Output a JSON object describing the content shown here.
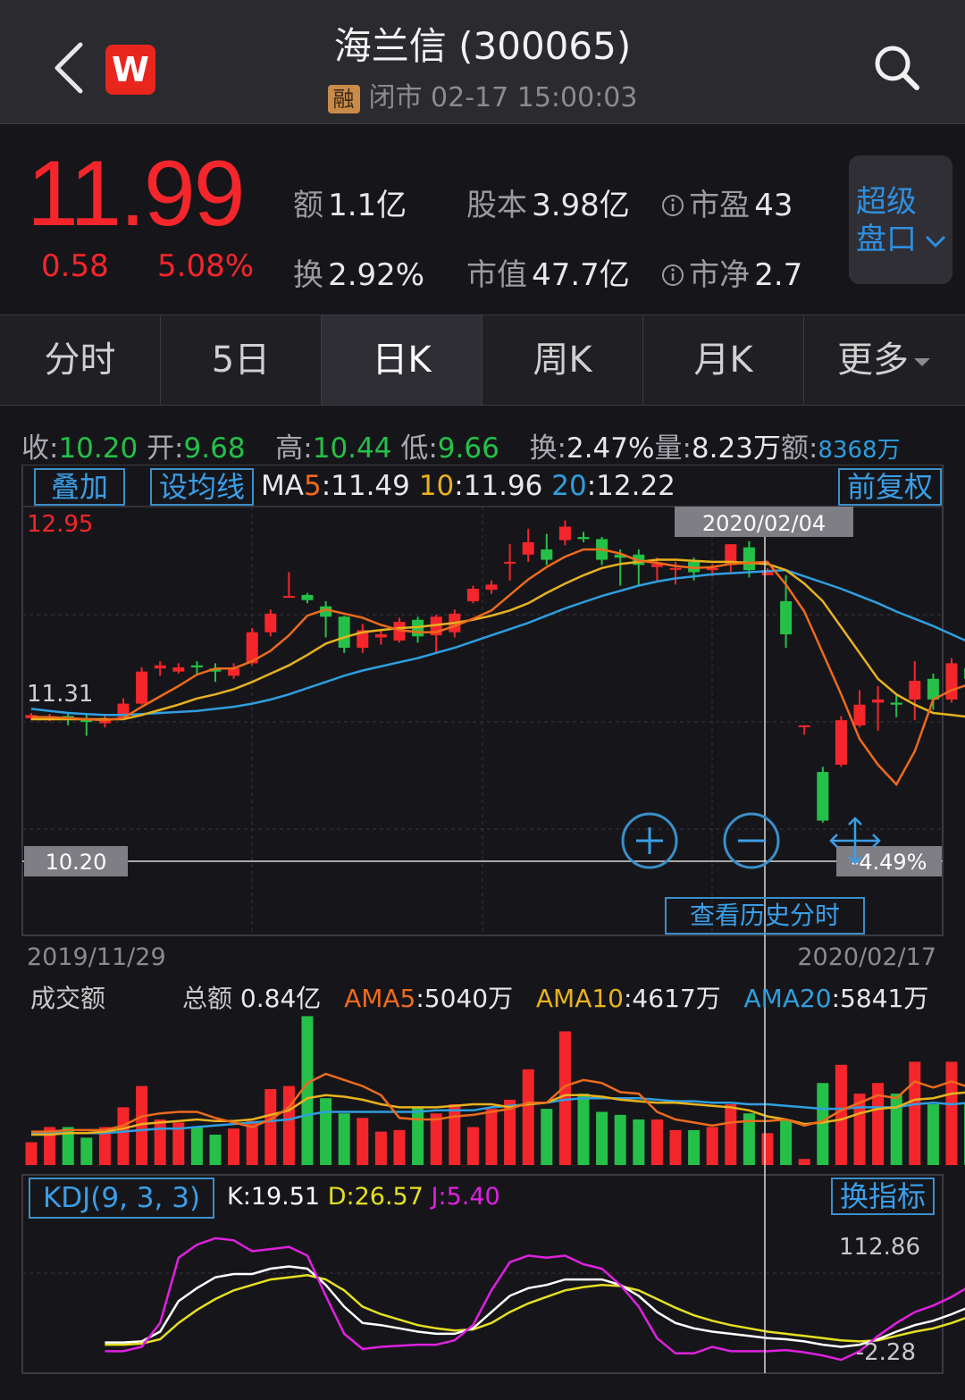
{
  "header": {
    "back_icon": "chevron-left-icon",
    "logo_text": "W",
    "title": "海兰信 (300065)",
    "badge": "融",
    "status": "闭市 02-17 15:00:03",
    "search_icon": "search-icon"
  },
  "quote": {
    "price": "11.99",
    "change": "0.58",
    "change_pct": "5.08%",
    "amount_label": "额",
    "amount": "1.1亿",
    "turnover_label": "换",
    "turnover": "2.92%",
    "share_cap_label": "股本",
    "share_cap": "3.98亿",
    "mkt_cap_label": "市值",
    "mkt_cap": "47.7亿",
    "pe_label": "市盈",
    "pe": "43",
    "pb_label": "市净",
    "pb": "2.7",
    "deep_book": "超级盘口",
    "price_color": "#f5262b"
  },
  "tabs": [
    {
      "label": "分时"
    },
    {
      "label": "5日"
    },
    {
      "label": "日K"
    },
    {
      "label": "周K"
    },
    {
      "label": "月K"
    },
    {
      "label": "更多"
    }
  ],
  "info_row": {
    "close_label": "收:",
    "close": "10.20",
    "open_label": "开:",
    "open": "9.68",
    "high_label": "高:",
    "high": "10.44",
    "low_label": "低:",
    "low": "9.66",
    "turn_label": "换:",
    "turn": "2.47%",
    "vol_label": "量:",
    "vol": "8.23万",
    "amt_label": "额:",
    "amt": "8368万"
  },
  "kline": {
    "overlay_btn": "叠加",
    "ma_btn": "设均线",
    "ma_prefix": "MA",
    "ma5_key": "5",
    "ma5": ":11.49",
    "ma10_key": "10",
    "ma10": ":11.96",
    "ma20_key": "20",
    "ma20": ":12.22",
    "adj_btn": "前复权",
    "y_high": "12.95",
    "y_mid": "11.31",
    "cursor_date": "2020/02/04",
    "cursor_price": "10.20",
    "cursor_pct": "-4.49%",
    "history_btn": "查看历史分时",
    "x_start": "2019/11/29",
    "x_end": "2020/02/17"
  },
  "volume": {
    "title": "成交额",
    "total_label": "总额",
    "total": "0.84亿",
    "ama5_label": "AMA5",
    "ama5": ":5040万",
    "ama10_label": "AMA10",
    "ama10": ":4617万",
    "ama20_label": "AMA20",
    "ama20": ":5841万"
  },
  "kdj": {
    "title": "KDJ(9, 3, 3)",
    "k_label": "K",
    "k": ":19.51",
    "d_label": "D",
    "d": ":26.57",
    "j_label": "J",
    "j": ":5.40",
    "switch_btn": "换指标",
    "y_top": "112.86",
    "y_bottom": "-2.28"
  },
  "colors": {
    "up": "#f5262b",
    "down": "#25c048",
    "ma5": "#ee6a1c",
    "ma10": "#e8b21e",
    "ma20": "#2f9ee0",
    "k": "#ffffff",
    "d": "#e6e020",
    "j": "#e020e0"
  },
  "chart_data": {
    "candles": [
      [
        11.07,
        11.1,
        11.05,
        11.12
      ],
      [
        11.08,
        11.09,
        11.04,
        11.11
      ],
      [
        11.09,
        11.06,
        11.0,
        11.12
      ],
      [
        11.05,
        11.04,
        10.9,
        11.12
      ],
      [
        11.02,
        11.05,
        10.98,
        11.1
      ],
      [
        11.08,
        11.21,
        11.06,
        11.26
      ],
      [
        11.21,
        11.52,
        11.2,
        11.56
      ],
      [
        11.55,
        11.58,
        11.48,
        11.62
      ],
      [
        11.52,
        11.56,
        11.5,
        11.6
      ],
      [
        11.58,
        11.56,
        11.48,
        11.62
      ],
      [
        11.55,
        11.52,
        11.42,
        11.6
      ],
      [
        11.48,
        11.55,
        11.45,
        11.6
      ],
      [
        11.6,
        11.9,
        11.58,
        11.94
      ],
      [
        11.9,
        12.08,
        11.86,
        12.12
      ],
      [
        12.25,
        12.25,
        12.24,
        12.48
      ],
      [
        12.26,
        12.21,
        12.18,
        12.28
      ],
      [
        12.15,
        12.05,
        11.85,
        12.2
      ],
      [
        12.05,
        11.75,
        11.7,
        12.06
      ],
      [
        11.75,
        11.92,
        11.7,
        11.98
      ],
      [
        11.85,
        11.88,
        11.78,
        11.92
      ],
      [
        11.82,
        12.0,
        11.8,
        12.04
      ],
      [
        12.02,
        11.86,
        11.8,
        12.05
      ],
      [
        11.87,
        12.05,
        11.7,
        12.07
      ],
      [
        11.9,
        12.08,
        11.85,
        12.12
      ],
      [
        12.2,
        12.32,
        12.18,
        12.35
      ],
      [
        12.31,
        12.36,
        12.27,
        12.4
      ],
      [
        12.58,
        12.58,
        12.4,
        12.75
      ],
      [
        12.65,
        12.77,
        12.58,
        12.9
      ],
      [
        12.7,
        12.6,
        12.55,
        12.85
      ],
      [
        12.79,
        12.92,
        12.74,
        12.98
      ],
      [
        12.82,
        12.8,
        12.77,
        12.87
      ],
      [
        12.8,
        12.6,
        12.55,
        12.82
      ],
      [
        12.65,
        12.62,
        12.35,
        12.7
      ],
      [
        12.65,
        12.55,
        12.35,
        12.7
      ],
      [
        12.53,
        12.56,
        12.4,
        12.62
      ],
      [
        12.52,
        12.52,
        12.36,
        12.58
      ],
      [
        12.58,
        12.48,
        12.4,
        12.62
      ],
      [
        12.5,
        12.52,
        12.44,
        12.56
      ],
      [
        12.55,
        12.75,
        12.47,
        12.75
      ],
      [
        12.72,
        12.5,
        12.43,
        12.78
      ],
      [
        12.45,
        12.5,
        12.46,
        12.52
      ],
      [
        12.2,
        11.88,
        11.75,
        12.45
      ],
      [
        11.0,
        11.0,
        10.91,
        11.0
      ],
      [
        10.55,
        10.08,
        10.06,
        10.6
      ],
      [
        10.62,
        11.05,
        10.6,
        11.09
      ],
      [
        11.0,
        11.2,
        10.98,
        11.34
      ],
      [
        11.22,
        11.25,
        10.95,
        11.38
      ],
      [
        11.22,
        11.2,
        11.08,
        11.3
      ],
      [
        11.25,
        11.43,
        11.05,
        11.62
      ],
      [
        11.45,
        11.25,
        11.15,
        11.5
      ],
      [
        11.25,
        11.6,
        11.22,
        11.65
      ],
      [
        11.55,
        11.45,
        11.4,
        11.62
      ],
      [
        11.4,
        11.45,
        11.23,
        11.55
      ],
      [
        11.41,
        11.82,
        11.4,
        11.84
      ]
    ],
    "ma5": [
      11.08,
      11.08,
      11.07,
      11.06,
      11.05,
      11.07,
      11.18,
      11.28,
      11.38,
      11.49,
      11.55,
      11.55,
      11.62,
      11.72,
      11.87,
      12.06,
      12.12,
      12.08,
      12.04,
      11.97,
      11.92,
      11.9,
      11.9,
      11.96,
      12.03,
      12.11,
      12.26,
      12.41,
      12.53,
      12.63,
      12.7,
      12.7,
      12.66,
      12.59,
      12.57,
      12.54,
      12.52,
      12.53,
      12.56,
      12.57,
      12.58,
      12.36,
      12.1,
      11.7,
      11.3,
      10.87,
      10.62,
      10.43,
      10.75,
      11.25,
      11.34,
      11.4,
      11.45,
      11.5
    ],
    "ma10": [
      11.06,
      11.06,
      11.06,
      11.06,
      11.06,
      11.06,
      11.1,
      11.15,
      11.2,
      11.26,
      11.3,
      11.35,
      11.42,
      11.5,
      11.58,
      11.68,
      11.79,
      11.85,
      11.9,
      11.92,
      11.94,
      11.95,
      11.97,
      11.99,
      12.02,
      12.06,
      12.11,
      12.18,
      12.28,
      12.37,
      12.45,
      12.52,
      12.56,
      12.58,
      12.6,
      12.6,
      12.59,
      12.58,
      12.58,
      12.57,
      12.56,
      12.5,
      12.37,
      12.2,
      11.95,
      11.7,
      11.45,
      11.3,
      11.2,
      11.12,
      11.1,
      11.08,
      11.12,
      11.0
    ],
    "ma20": [
      11.16,
      11.14,
      11.12,
      11.11,
      11.1,
      11.1,
      11.11,
      11.12,
      11.13,
      11.14,
      11.16,
      11.18,
      11.21,
      11.25,
      11.3,
      11.36,
      11.42,
      11.48,
      11.53,
      11.57,
      11.61,
      11.65,
      11.7,
      11.75,
      11.81,
      11.87,
      11.93,
      11.99,
      12.06,
      12.13,
      12.19,
      12.25,
      12.3,
      12.35,
      12.39,
      12.42,
      12.44,
      12.46,
      12.47,
      12.48,
      12.49,
      12.5,
      12.44,
      12.38,
      12.32,
      12.25,
      12.18,
      12.1,
      12.03,
      11.96,
      11.88,
      11.8,
      11.74,
      11.71
    ],
    "turnover": [
      0.15,
      0.25,
      0.25,
      0.18,
      0.25,
      0.38,
      0.52,
      0.3,
      0.28,
      0.25,
      0.2,
      0.24,
      0.29,
      0.5,
      0.52,
      0.98,
      0.44,
      0.34,
      0.31,
      0.22,
      0.23,
      0.38,
      0.34,
      0.4,
      0.25,
      0.37,
      0.43,
      0.63,
      0.37,
      0.88,
      0.47,
      0.35,
      0.33,
      0.3,
      0.3,
      0.23,
      0.23,
      0.25,
      0.4,
      0.34,
      0.21,
      0.3,
      0.04,
      0.54,
      0.66,
      0.47,
      0.54,
      0.47,
      0.68,
      0.4,
      0.68,
      0.4,
      0.44,
      0.76
    ],
    "ama5_vals": [
      0.22,
      0.22,
      0.23,
      0.23,
      0.23,
      0.26,
      0.32,
      0.34,
      0.35,
      0.35,
      0.31,
      0.28,
      0.25,
      0.3,
      0.38,
      0.54,
      0.6,
      0.56,
      0.52,
      0.46,
      0.31,
      0.3,
      0.3,
      0.32,
      0.33,
      0.35,
      0.37,
      0.41,
      0.41,
      0.52,
      0.56,
      0.54,
      0.48,
      0.47,
      0.35,
      0.3,
      0.28,
      0.26,
      0.28,
      0.29,
      0.29,
      0.3,
      0.26,
      0.29,
      0.36,
      0.41,
      0.46,
      0.44,
      0.55,
      0.51,
      0.55,
      0.51,
      0.52,
      0.54
    ],
    "ama10_vals": [
      0.2,
      0.2,
      0.21,
      0.21,
      0.22,
      0.24,
      0.27,
      0.28,
      0.29,
      0.3,
      0.29,
      0.29,
      0.3,
      0.33,
      0.36,
      0.44,
      0.46,
      0.45,
      0.43,
      0.4,
      0.38,
      0.38,
      0.38,
      0.39,
      0.4,
      0.4,
      0.38,
      0.4,
      0.41,
      0.46,
      0.46,
      0.45,
      0.43,
      0.42,
      0.41,
      0.41,
      0.4,
      0.39,
      0.38,
      0.36,
      0.32,
      0.3,
      0.27,
      0.28,
      0.3,
      0.34,
      0.37,
      0.38,
      0.43,
      0.44,
      0.47,
      0.48,
      0.48,
      0.5
    ],
    "ama20_vals": [
      0.21,
      0.21,
      0.21,
      0.21,
      0.21,
      0.22,
      0.23,
      0.24,
      0.24,
      0.25,
      0.26,
      0.27,
      0.28,
      0.29,
      0.3,
      0.33,
      0.35,
      0.35,
      0.35,
      0.35,
      0.35,
      0.35,
      0.36,
      0.36,
      0.36,
      0.38,
      0.39,
      0.4,
      0.41,
      0.43,
      0.44,
      0.44,
      0.44,
      0.44,
      0.43,
      0.42,
      0.42,
      0.41,
      0.41,
      0.4,
      0.4,
      0.39,
      0.38,
      0.37,
      0.37,
      0.38,
      0.38,
      0.38,
      0.4,
      0.41,
      0.4,
      0.41,
      0.41,
      0.42
    ],
    "k": [
      12,
      12,
      13,
      22,
      50,
      62,
      72,
      75,
      75,
      80,
      82,
      80,
      65,
      45,
      30,
      28,
      25,
      22,
      20,
      20,
      25,
      40,
      55,
      62,
      65,
      70,
      70,
      70,
      65,
      55,
      40,
      30,
      25,
      22,
      20,
      18,
      16,
      15,
      13,
      10,
      8,
      10,
      15,
      22,
      28,
      32,
      38,
      45,
      52,
      58
    ],
    "d": [
      10,
      10,
      11,
      15,
      30,
      42,
      52,
      60,
      65,
      70,
      72,
      74,
      70,
      60,
      45,
      38,
      33,
      28,
      25,
      23,
      24,
      30,
      40,
      48,
      54,
      60,
      63,
      65,
      64,
      60,
      52,
      44,
      37,
      32,
      28,
      25,
      22,
      20,
      18,
      16,
      14,
      13,
      14,
      18,
      22,
      25,
      30,
      36,
      42,
      50
    ],
    "j": [
      4,
      4,
      8,
      30,
      90,
      102,
      108,
      106,
      96,
      98,
      100,
      92,
      55,
      20,
      6,
      8,
      9,
      10,
      10,
      14,
      28,
      60,
      86,
      92,
      90,
      92,
      84,
      80,
      65,
      45,
      16,
      2,
      2,
      8,
      4,
      4,
      4,
      5,
      3,
      0,
      -4,
      4,
      18,
      30,
      40,
      46,
      54,
      64,
      72,
      78
    ],
    "kdj_ylim": [
      -2.28,
      112.86
    ]
  }
}
